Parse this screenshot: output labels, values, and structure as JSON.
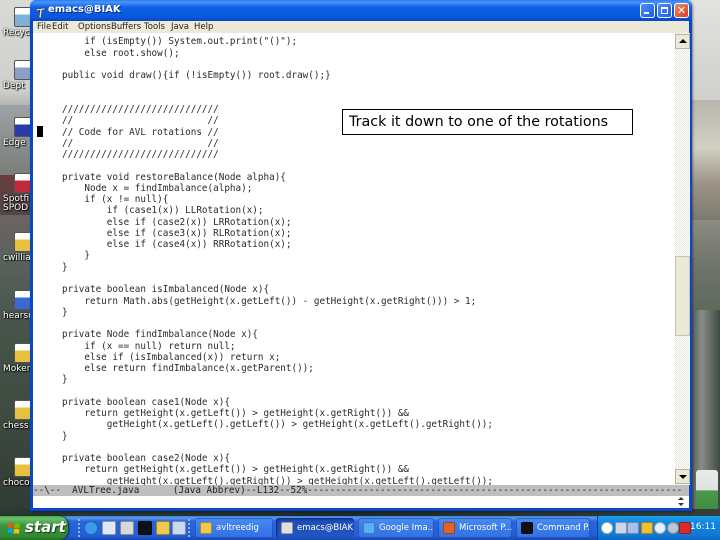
{
  "window": {
    "title": "emacs@BIAK",
    "menu": [
      "File",
      "Edit",
      "Options",
      "Buffers",
      "Tools",
      "Java",
      "Help"
    ]
  },
  "editor": {
    "lines": [
      "    if (isEmpty()) System.out.print(\"()\");",
      "    else root.show();",
      "",
      "public void draw(){if (!isEmpty()) root.draw();}",
      "",
      "",
      "////////////////////////////",
      "//                        //",
      "// Code for AVL rotations //",
      "//                        //",
      "////////////////////////////",
      "",
      "private void restoreBalance(Node alpha){",
      "    Node x = findImbalance(alpha);",
      "    if (x != null){",
      "        if (case1(x)) LLRotation(x);",
      "        else if (case2(x)) LRRotation(x);",
      "        else if (case3(x)) RLRotation(x);",
      "        else if (case4(x)) RRRotation(x);",
      "    }",
      "}",
      "",
      "private boolean isImbalanced(Node x){",
      "    return Math.abs(getHeight(x.getLeft()) - getHeight(x.getRight())) > 1;",
      "}",
      "",
      "private Node findImbalance(Node x){",
      "    if (x == null) return null;",
      "    else if (isImbalanced(x)) return x;",
      "    else return findImbalance(x.getParent());",
      "}",
      "",
      "private boolean case1(Node x){",
      "    return getHeight(x.getLeft()) > getHeight(x.getRight()) &&",
      "        getHeight(x.getLeft().getLeft()) > getHeight(x.getLeft().getRight());",
      "}",
      "",
      "private boolean case2(Node x){",
      "    return getHeight(x.getLeft()) > getHeight(x.getRight()) &&",
      "        getHeight(x.getLeft().getRight()) > getHeight(x.getLeft().getLeft());"
    ],
    "mode_line": "--\\--  AVLTree.java      (Java Abbrev)--L132--52%-------------------------------------------------------------------",
    "minibuffer": ""
  },
  "scrollbar": {
    "position": 0.61,
    "visible_fraction": 0.19
  },
  "callout": {
    "text": "Track it down to one of the rotations"
  },
  "desktop": {
    "icons": [
      {
        "label": "Recycl",
        "icon": "recycle-bin-icon",
        "color": "#7fb0d8"
      },
      {
        "label": "Dept",
        "icon": "network-shortcut-icon",
        "color": "#8aa0c8"
      },
      {
        "label": "Edge",
        "icon": "window-shortcut-icon",
        "color": "#2a3aa8"
      },
      {
        "label": "Spotfi\nSPOD",
        "icon": "spotfire-shortcut-icon",
        "color": "#c02a3a"
      },
      {
        "label": "cwillia",
        "icon": "document-icon",
        "color": "#e8c040"
      },
      {
        "label": "hearsu",
        "icon": "audio-file-icon",
        "color": "#3a6ad0"
      },
      {
        "label": "Moken_",
        "icon": "document-icon",
        "color": "#e8c040"
      },
      {
        "label": "chess",
        "icon": "document-icon",
        "color": "#e8c040"
      },
      {
        "label": "choco",
        "icon": "document-icon",
        "color": "#e8c040"
      }
    ]
  },
  "taskbar": {
    "start_label": "start",
    "quick_launch": [
      {
        "icon": "internet-explorer-icon",
        "color": "#3a9af0"
      },
      {
        "icon": "outlook-express-icon",
        "color": "#e0e8f8"
      },
      {
        "icon": "emacs-icon",
        "color": "#d8d8d8"
      },
      {
        "icon": "command-prompt-icon",
        "color": "#101010"
      },
      {
        "icon": "folder-icon",
        "color": "#f0c850"
      },
      {
        "icon": "network-drive-icon",
        "color": "#c8d8f0"
      }
    ],
    "tasks": [
      {
        "label": "avltreedig",
        "icon": "folder-icon",
        "color": "#f0c850",
        "active": false
      },
      {
        "label": "emacs@BIAK",
        "icon": "emacs-icon",
        "color": "#e0e0e0",
        "active": true
      },
      {
        "label": "Google Ima...",
        "icon": "internet-explorer-icon",
        "color": "#5ab0f8",
        "active": false
      },
      {
        "label": "Microsoft P...",
        "icon": "powerpoint-icon",
        "color": "#e0642a",
        "active": false
      },
      {
        "label": "Command P...",
        "icon": "command-prompt-icon",
        "color": "#101010",
        "active": false
      }
    ],
    "tray": {
      "icons": [
        {
          "icon": "show-hidden-icons-chevron",
          "color": "#ffffff"
        },
        {
          "icon": "network-connection-icon",
          "color": "#c8d8f0"
        },
        {
          "icon": "display-icon",
          "color": "#a8c0e8"
        },
        {
          "icon": "messenger-icon",
          "color": "#f0c030"
        },
        {
          "icon": "search-icon",
          "color": "#e0f0ff"
        },
        {
          "icon": "volume-icon",
          "color": "#b8c8d8"
        },
        {
          "icon": "ati-icon",
          "color": "#d82a2a"
        }
      ],
      "clock": "16:11"
    }
  },
  "colors": {
    "titlebar_blue": "#0a58dc",
    "menubar": "#ece9d8",
    "modeline": "#bebebe",
    "close_red": "#d2401e",
    "start_green": "#3a943a",
    "taskbar_blue": "#235fd8"
  }
}
